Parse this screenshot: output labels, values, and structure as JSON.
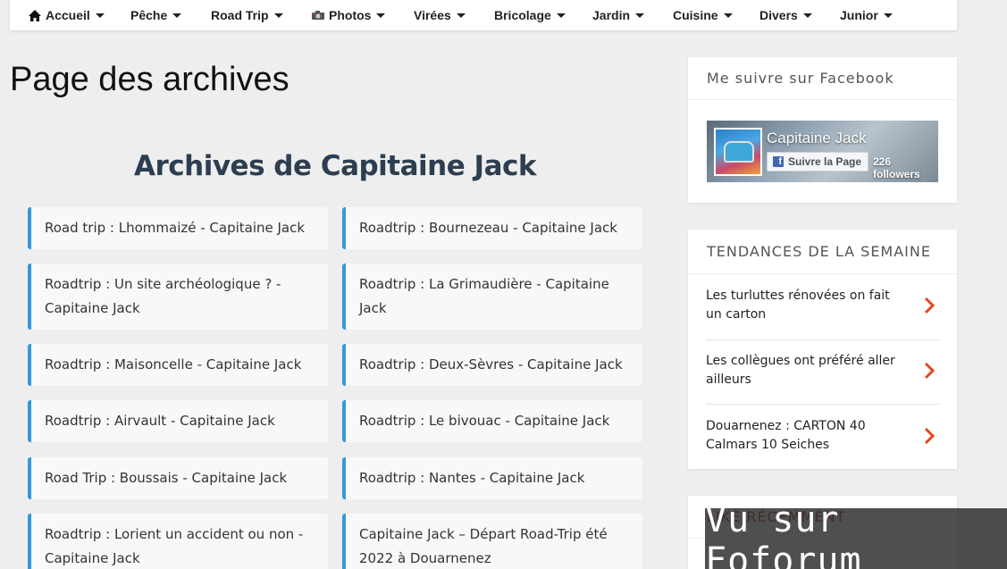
{
  "nav": {
    "items": [
      {
        "label": "Accueil",
        "icon": "home-icon"
      },
      {
        "label": "Pêche"
      },
      {
        "label": "Road Trip"
      },
      {
        "label": "Photos",
        "icon": "camera-icon"
      },
      {
        "label": "Virées"
      },
      {
        "label": "Bricolage"
      },
      {
        "label": "Jardin"
      },
      {
        "label": "Cuisine"
      },
      {
        "label": "Divers"
      },
      {
        "label": "Junior"
      }
    ]
  },
  "main": {
    "page_title": "Page des archives",
    "archive_heading": "Archives de Capitaine Jack",
    "archives": [
      "Road trip : Lhommaizé - Capitaine Jack",
      "Roadtrip : Bournezeau - Capitaine Jack",
      "Roadtrip : Un site archéologique ? - Capitaine Jack",
      "Roadtrip : La Grimaudière - Capitaine Jack",
      "Roadtrip : Maisoncelle - Capitaine Jack",
      "Roadtrip : Deux-Sèvres - Capitaine Jack",
      "Roadtrip : Airvault - Capitaine Jack",
      "Roadtrip : Le bivouac - Capitaine Jack",
      "Road Trip : Boussais - Capitaine Jack",
      "Roadtrip : Nantes - Capitaine Jack",
      "Roadtrip : Lorient un accident ou non - Capitaine Jack",
      "Capitaine Jack – Départ Road-Trip été 2022 à Douarnenez"
    ],
    "accent_color": "#3498db"
  },
  "sidebar": {
    "facebook": {
      "title": "Me suivre sur Facebook",
      "page_name": "Capitaine Jack",
      "follow_label": "Suivre la Page",
      "followers": "226 followers"
    },
    "trends": {
      "title": "TENDANCES DE LA SEMAINE",
      "items": [
        "Les turluttes rénovées on fait un carton",
        "Les collègues ont préféré aller ailleurs",
        "Douarnenez : CARTON 40 Calmars 10 Seiches"
      ],
      "chevron_color": "#e8451e"
    },
    "liked": {
      "title": "LIKÉ RÉCEMMENT"
    }
  },
  "watermark": {
    "text": "Vu sur Foforum"
  }
}
